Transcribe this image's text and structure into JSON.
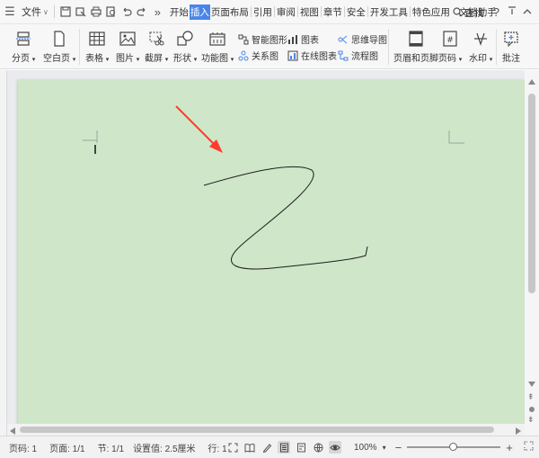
{
  "menubar": {
    "file_label": "文件",
    "tabs": [
      {
        "label": "开始",
        "active": false
      },
      {
        "label": "插入",
        "active": true
      },
      {
        "label": "页面布局",
        "active": false
      },
      {
        "label": "引用",
        "active": false
      },
      {
        "label": "审阅",
        "active": false
      },
      {
        "label": "视图",
        "active": false
      },
      {
        "label": "章节",
        "active": false
      },
      {
        "label": "安全",
        "active": false
      },
      {
        "label": "开发工具",
        "active": false
      },
      {
        "label": "特色应用",
        "active": false
      },
      {
        "label": "文档助手",
        "active": false
      }
    ],
    "search_label": "查找",
    "help_glyph": "?",
    "more_glyph": "»"
  },
  "ribbon": {
    "page_break": "分页",
    "blank_page": "空白页",
    "table": "表格",
    "picture": "图片",
    "screenshot": "截屏",
    "shape": "形状",
    "function_chart": "功能图",
    "smart_shape": "智能图形",
    "relation_chart": "关系图",
    "chart": "图表",
    "online_chart": "在线图表",
    "mind_map": "思维导图",
    "flowchart": "流程图",
    "header_footer": "页眉和页脚",
    "page_number": "页码",
    "watermark": "水印",
    "comment": "批注"
  },
  "status": {
    "page_number": "页码: 1",
    "page_count": "页面: 1/1",
    "section": "节: 1/1",
    "setting_value": "设置值: 2.5厘米",
    "row": "行: 1",
    "zoom_text": "100%",
    "zoom_percent": 100,
    "zoom_slider_fraction": 0.5
  },
  "colors": {
    "page_background": "#cfe6c9",
    "active_tab": "#4a86e8",
    "arrow": "#ff3b30"
  },
  "icons": [
    "menu-icon",
    "save-icon",
    "print-icon",
    "preview-icon",
    "undo-icon",
    "redo-icon",
    "search-icon",
    "collapse-icon"
  ]
}
